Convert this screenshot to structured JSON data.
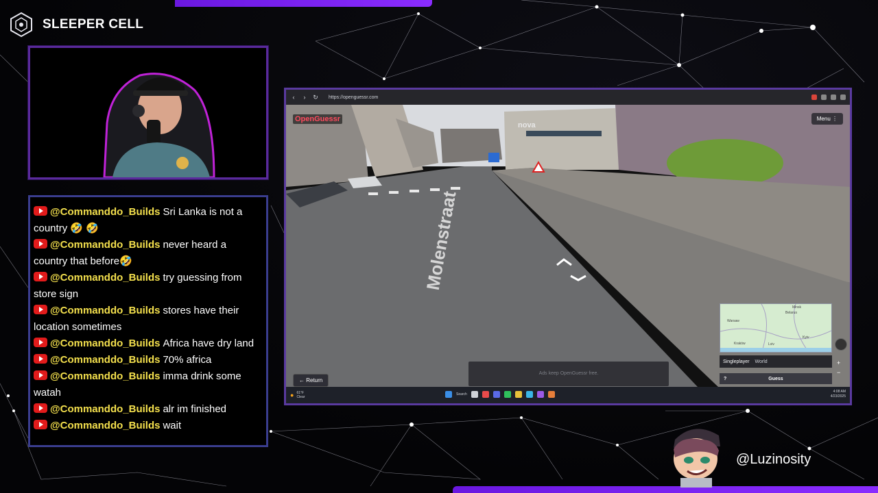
{
  "brand": {
    "name": "SLEEPER CELL"
  },
  "chat": {
    "messages": [
      {
        "user": "@Commanddo_Builds",
        "text": "Sri Lanka is not a country 🤣 🤣"
      },
      {
        "user": "@Commanddo_Builds",
        "text": "never heard a country that before🤣"
      },
      {
        "user": "@Commanddo_Builds",
        "text": "try guessing from store sign"
      },
      {
        "user": "@Commanddo_Builds",
        "text": "stores have their location sometimes"
      },
      {
        "user": "@Commanddo_Builds",
        "text": "Africa have dry land"
      },
      {
        "user": "@Commanddo_Builds",
        "text": "70% africa"
      },
      {
        "user": "@Commanddo_Builds",
        "text": "imma drink some watah"
      },
      {
        "user": "@Commanddo_Builds",
        "text": "alr im finished"
      },
      {
        "user": "@Commanddo_Builds",
        "text": "wait"
      }
    ]
  },
  "browser": {
    "url": "https://openguessr.com",
    "nav_back": "‹",
    "nav_forward": "›",
    "nav_reload": "↻"
  },
  "game": {
    "logo": "OpenGuessr",
    "menu_label": "Menu ⋮",
    "return_label": "← Return",
    "ads_text": "Ads keep OpenGuessr free.",
    "street_sign": "Molenstraat",
    "store_sign": "nova",
    "mode_label": "Singleplayer",
    "world_label": "World",
    "guess_label": "Guess",
    "guess_help": "?",
    "zoom_in": "+",
    "zoom_out": "−",
    "minimap_labels": [
      "Belarus",
      "Warsaw",
      "Kraków",
      "Kyiv",
      "Lviv",
      "Minsk"
    ]
  },
  "taskbar": {
    "weather_temp": "61°F",
    "weather_desc": "Clear",
    "search_label": "Search",
    "time": "4:08 AM",
    "date": "4/23/2025"
  },
  "streamer": {
    "handle": "@Luzinosity"
  },
  "colors": {
    "accent": "#7a22f0",
    "chat_user": "#f4e04d",
    "yt_red": "#e21b1b",
    "frame_cam": "#5a2a9c",
    "frame_chat": "#3a3d8e"
  },
  "icons": {
    "brand": "hexagon-eye-icon",
    "youtube": "youtube-icon"
  }
}
